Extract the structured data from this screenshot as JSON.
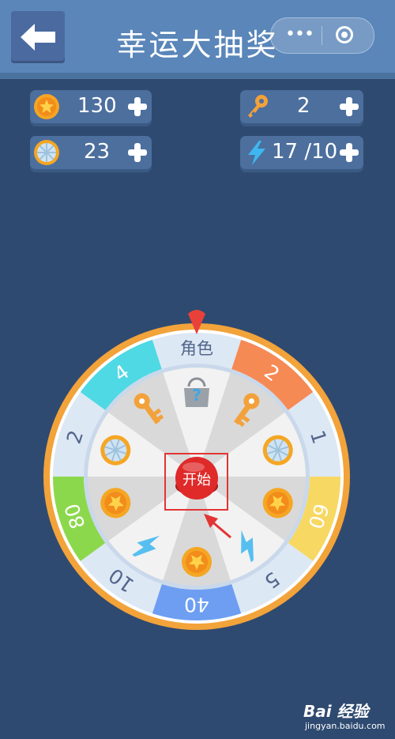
{
  "header": {
    "title": "幸运大抽奖",
    "back_icon": "arrow-left-icon",
    "menu_icon": "more-dots-icon",
    "close_icon": "record-circle-icon"
  },
  "resources": [
    {
      "name": "coin",
      "icon": "star-coin-icon",
      "value": "130"
    },
    {
      "name": "key",
      "icon": "key-icon",
      "value": "2"
    },
    {
      "name": "ticket",
      "icon": "silver-coin-icon",
      "value": "23"
    },
    {
      "name": "energy",
      "icon": "lightning-icon",
      "value": "17 /10"
    }
  ],
  "wheel": {
    "segment_labels": [
      "角色",
      "2",
      "1",
      "60",
      "5",
      "40",
      "10",
      "80",
      "2",
      "4"
    ],
    "segment_prizes": [
      "mystery-box-icon",
      "key-icon",
      "silver-coin-icon",
      "star-coin-icon",
      "lightning-icon",
      "star-coin-icon",
      "lightning-icon",
      "star-coin-icon",
      "silver-coin-icon",
      "key-icon"
    ],
    "start_label": "开始",
    "colors": {
      "ring": "#f2a33a",
      "orange": "#f58a55",
      "yellow": "#f7d862",
      "blue": "#6d9ef2",
      "green": "#8cd84c",
      "cyan": "#4ed9e4",
      "light": "#dde8f5",
      "start": "#e02a2a"
    }
  },
  "watermark": {
    "logo": "Bai  经验",
    "url": "jingyan.baidu.com"
  }
}
